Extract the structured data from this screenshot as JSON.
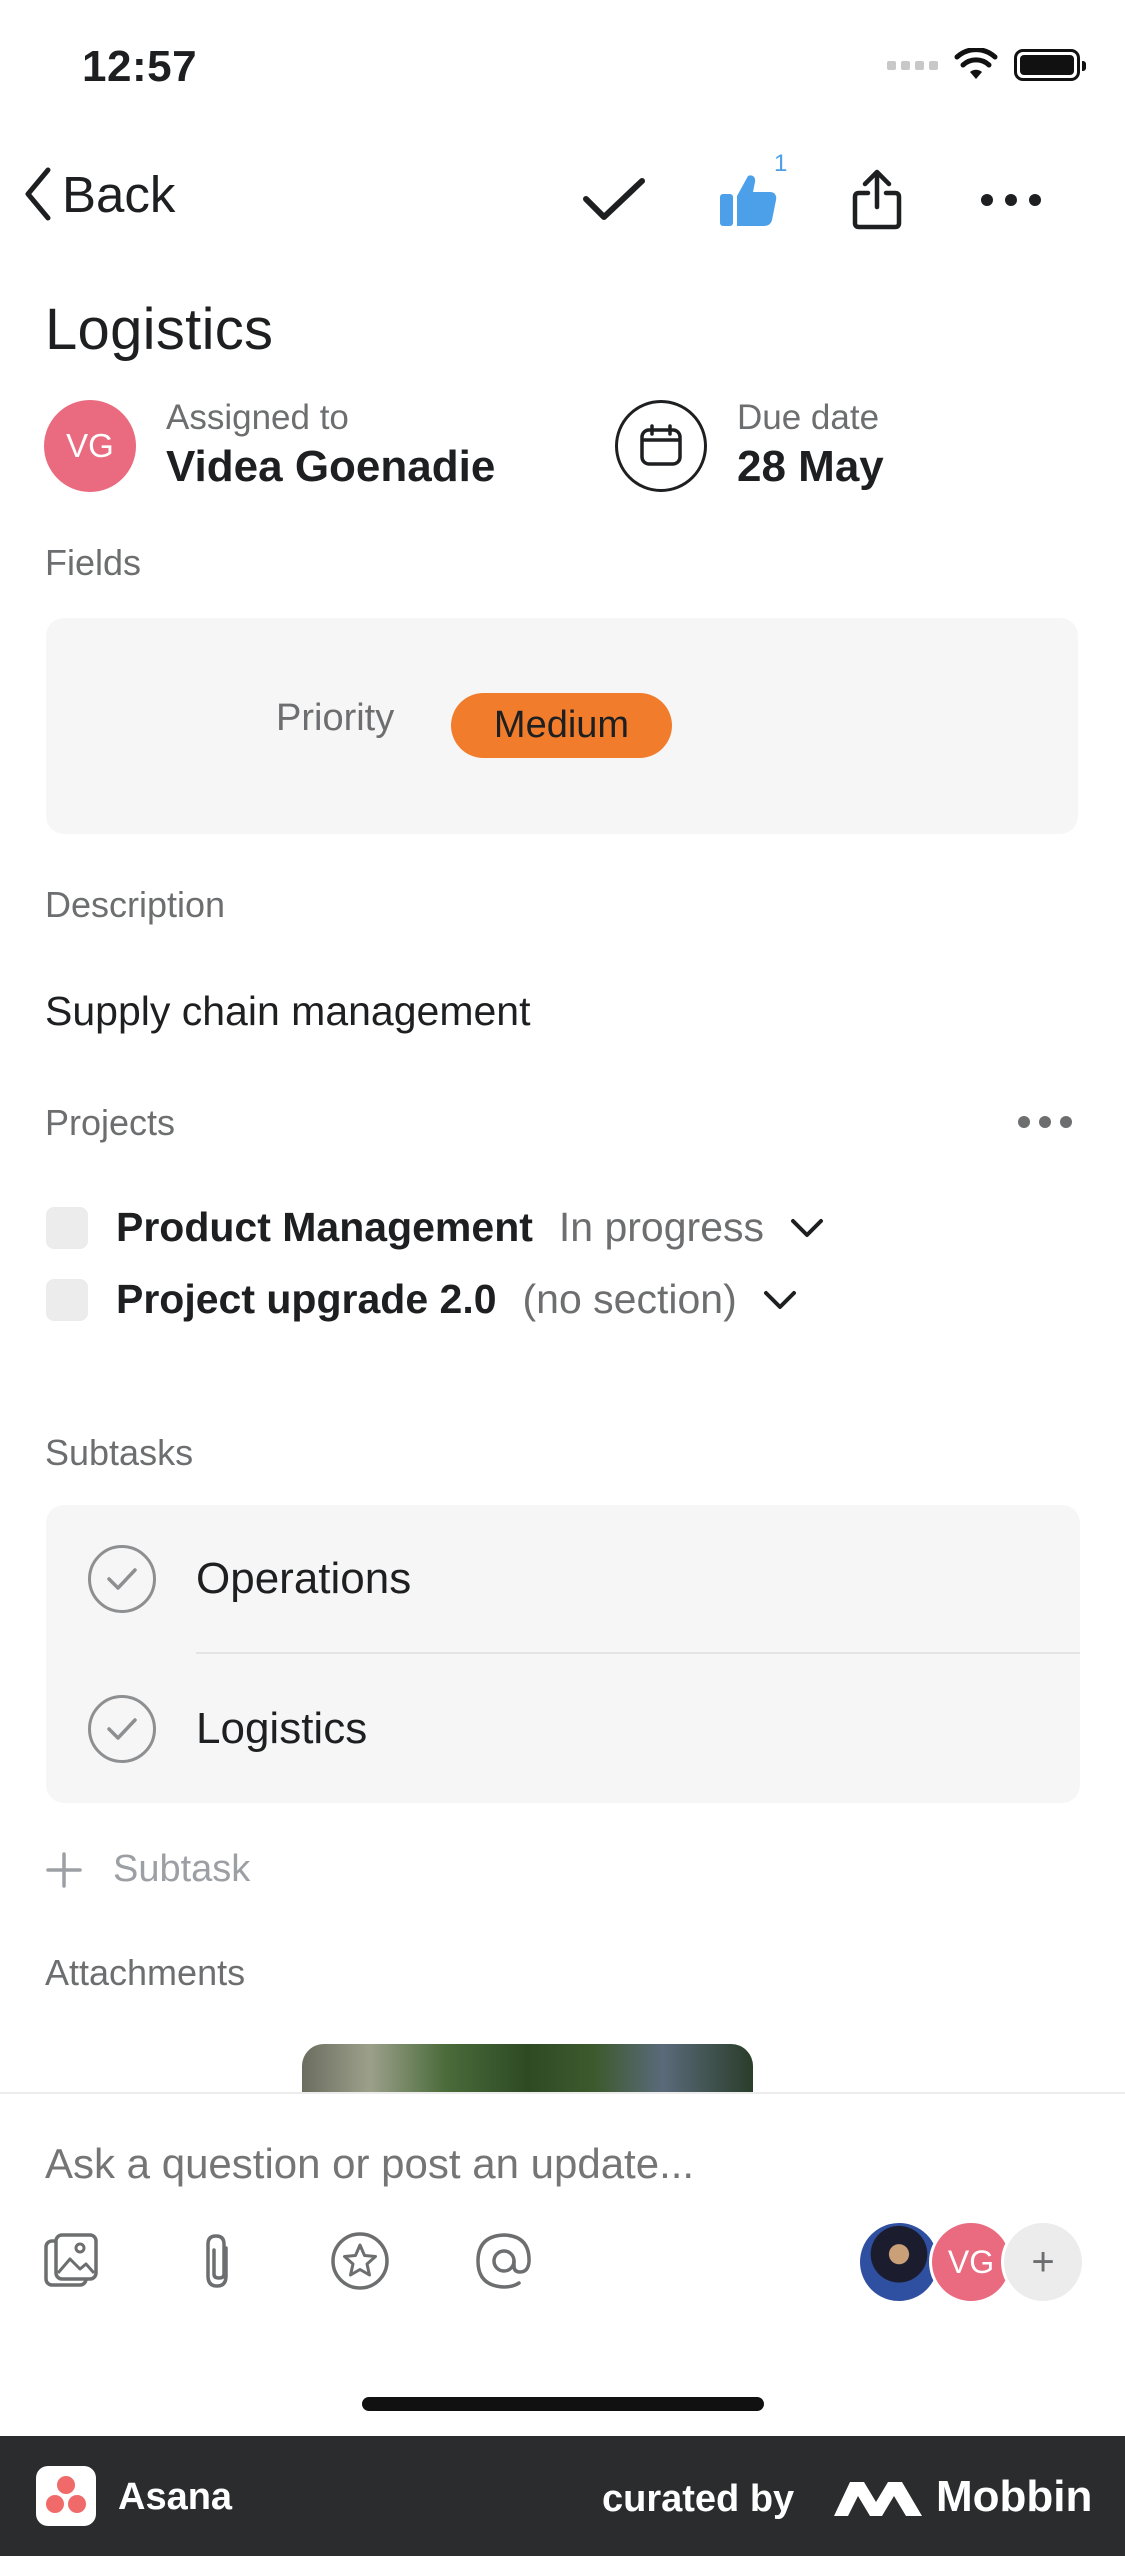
{
  "status_bar": {
    "time": "12:57"
  },
  "nav": {
    "back_label": "Back",
    "like_count": "1"
  },
  "task": {
    "title": "Logistics",
    "assignee": {
      "label": "Assigned to",
      "name": "Videa Goenadie",
      "initials": "VG"
    },
    "due": {
      "label": "Due date",
      "value": "28 May"
    }
  },
  "fields": {
    "heading": "Fields",
    "priority_label": "Priority",
    "priority_value": "Medium",
    "priority_color": "#f17d2c"
  },
  "description": {
    "heading": "Description",
    "text": "Supply chain management"
  },
  "projects": {
    "heading": "Projects",
    "items": [
      {
        "name": "Product Management",
        "section": "In progress"
      },
      {
        "name": "Project upgrade 2.0",
        "section": "(no section)"
      }
    ]
  },
  "subtasks": {
    "heading": "Subtasks",
    "items": [
      {
        "name": "Operations"
      },
      {
        "name": "Logistics"
      }
    ],
    "add_label": "Subtask"
  },
  "attachments": {
    "heading": "Attachments"
  },
  "composer": {
    "placeholder": "Ask a question or post an update...",
    "collaborator_initials": "VG",
    "add_symbol": "+"
  },
  "footer": {
    "app_name": "Asana",
    "curated_by": "curated by",
    "brand": "Mobbin"
  },
  "colors": {
    "accent_like": "#4ba0e9",
    "avatar_pink": "#ea6b7f",
    "footer_bg": "#2b2c2d"
  }
}
